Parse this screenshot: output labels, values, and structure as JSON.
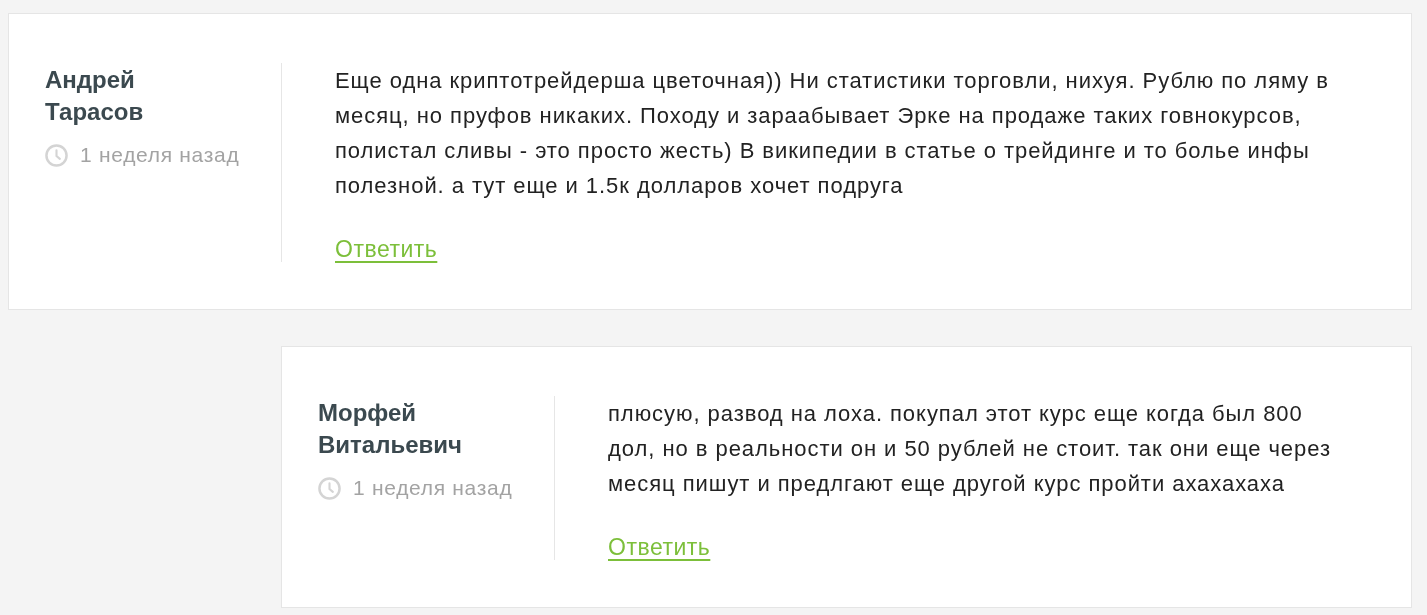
{
  "comments": [
    {
      "author": "Андрей Тарасов",
      "time": "1 неделя назад",
      "text": "Еще одна криптотрейдерша цветочная)) Ни статистики торговли, нихуя. Рублю по ляму в месяц, но пруфов никаких. Походу и зараабывает Эрке на продаже таких говнокурсов, полистал сливы - это просто жесть) В википедии в статье о трейдинге и то болье инфы полезной. а тут еще и 1.5к долларов хочет подруга",
      "reply_link": "Ответить",
      "replies": [
        {
          "author": "Морфей Витальевич",
          "time": "1 неделя назад",
          "text": "плюсую, развод на лоха. покупал этот курс еще когда был 800 дол, но в реальности он и 50 рублей не стоит. так они еще через месяц пишут и предлгают еще другой курс пройти ахахахаха",
          "reply_link": "Ответить"
        }
      ]
    }
  ]
}
